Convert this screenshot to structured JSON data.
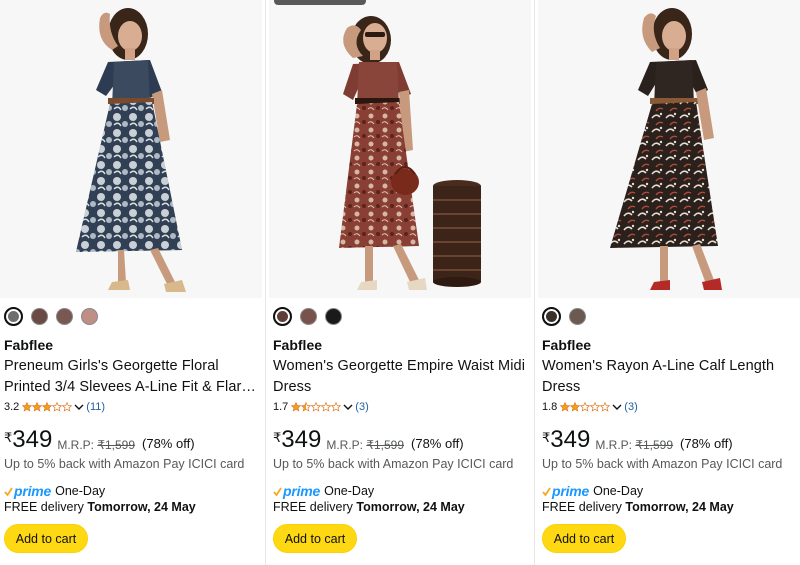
{
  "products": [
    {
      "brand": "Fabflee",
      "title_line1": "Preneum Girls's Georgette Floral",
      "title_line2": "Printed 3/4 Slevees A-Line Fit & Flar…",
      "rating": "3.2",
      "stars_value": 3,
      "review_count": "(11)",
      "currency": "₹",
      "price": "349",
      "mrp_label": "M.R.P:",
      "mrp": "₹1,599",
      "discount": "(78% off)",
      "cashback": "Up to 5% back with Amazon Pay ICICI card",
      "prime_label": "prime",
      "prime_suffix": "One-Day",
      "delivery_prefix": "FREE delivery",
      "delivery_date": "Tomorrow, 24 May",
      "cart_label": "Add to cart",
      "swatch_colors": [
        "#6e6e6e",
        "#6b4a44",
        "#7a5852",
        "#bf8f86"
      ],
      "selected_swatch": 0
    },
    {
      "brand": "Fabflee",
      "title_line1": "Women's Georgette Empire Waist Midi",
      "title_line2": "Dress",
      "rating": "1.7",
      "stars_value": 1.5,
      "review_count": "(3)",
      "currency": "₹",
      "price": "349",
      "mrp_label": "M.R.P:",
      "mrp": "₹1,599",
      "discount": "(78% off)",
      "cashback": "Up to 5% back with Amazon Pay ICICI card",
      "prime_label": "prime",
      "prime_suffix": "One-Day",
      "delivery_prefix": "FREE delivery",
      "delivery_date": "Tomorrow, 24 May",
      "cart_label": "Add to cart",
      "swatch_colors": [
        "#5e3e38",
        "#7a524c",
        "#1a1a1a"
      ],
      "selected_swatch": 0
    },
    {
      "brand": "Fabflee",
      "title_line1": "Women's Rayon A-Line Calf Length",
      "title_line2": "Dress",
      "rating": "1.8",
      "stars_value": 2,
      "review_count": "(3)",
      "currency": "₹",
      "price": "349",
      "mrp_label": "M.R.P:",
      "mrp": "₹1,599",
      "discount": "(78% off)",
      "cashback": "Up to 5% back with Amazon Pay ICICI card",
      "prime_label": "prime",
      "prime_suffix": "One-Day",
      "delivery_prefix": "FREE delivery",
      "delivery_date": "Tomorrow, 24 May",
      "cart_label": "Add to cart",
      "swatch_colors": [
        "#3a2f2a",
        "#6b5a50"
      ],
      "selected_swatch": 0
    }
  ],
  "colors": {
    "star": "#f49f1c",
    "link": "#2162a1",
    "prime": "#1a98ff",
    "cart": "#ffd814"
  }
}
